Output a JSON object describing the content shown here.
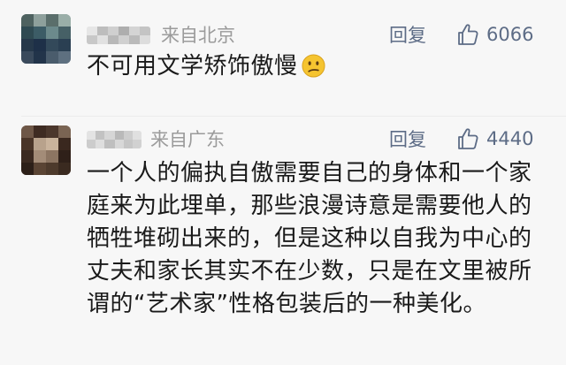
{
  "comments": [
    {
      "location": "来自北京",
      "reply_label": "回复",
      "like_count": "6066",
      "text": "不可用文学矫饰傲慢",
      "emoji": "confused-face-icon"
    },
    {
      "location": "来自广东",
      "reply_label": "回复",
      "like_count": "4440",
      "text": "一个人的偏执自傲需要自己的身体和一个家庭来为此埋单，那些浪漫诗意是需要他人的牺牲堆砌出来的，但是这种以自我为中心的丈夫和家长其实不在少数，只是在文里被所谓的“艺术家”性格包装后的一种美化。"
    }
  ],
  "colors": {
    "background": "#f7f7f7",
    "meta_text": "#9b9b9b",
    "action_text": "#5d6c86",
    "body_text": "#1a1a1a"
  }
}
